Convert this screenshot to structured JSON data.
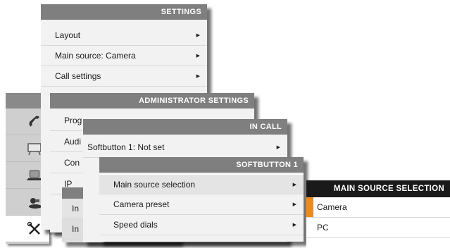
{
  "settings": {
    "title": "SETTINGS",
    "items": [
      {
        "label": "Layout"
      },
      {
        "label": "Main source: Camera"
      },
      {
        "label": "Call settings"
      }
    ]
  },
  "admin": {
    "title": "ADMINISTRATOR SETTINGS",
    "items": [
      {
        "label": "Prog"
      },
      {
        "label": "Audi"
      },
      {
        "label": "Con"
      },
      {
        "label": "IP"
      }
    ]
  },
  "dialog": {
    "items": [
      {
        "label": "In"
      },
      {
        "label": "In"
      }
    ]
  },
  "incall": {
    "title": "IN CALL",
    "items": [
      {
        "label": "Softbutton 1: Not set"
      }
    ]
  },
  "softbutton": {
    "title": "SOFTBUTTON 1",
    "items": [
      {
        "label": "Main source selection"
      },
      {
        "label": "Camera preset"
      },
      {
        "label": "Speed dials"
      }
    ]
  },
  "source_selection": {
    "title": "MAIN SOURCE SELECTION",
    "options": [
      {
        "label": "Camera",
        "selected": true
      },
      {
        "label": "PC",
        "selected": false
      }
    ]
  },
  "icons": [
    "phone-icon",
    "whiteboard-icon",
    "laptop-icon",
    "camera-icon",
    "tools-icon"
  ],
  "colors": {
    "header": "#7f7f7f",
    "header_dark": "#1a1a1a",
    "accent": "#f08a1a"
  }
}
